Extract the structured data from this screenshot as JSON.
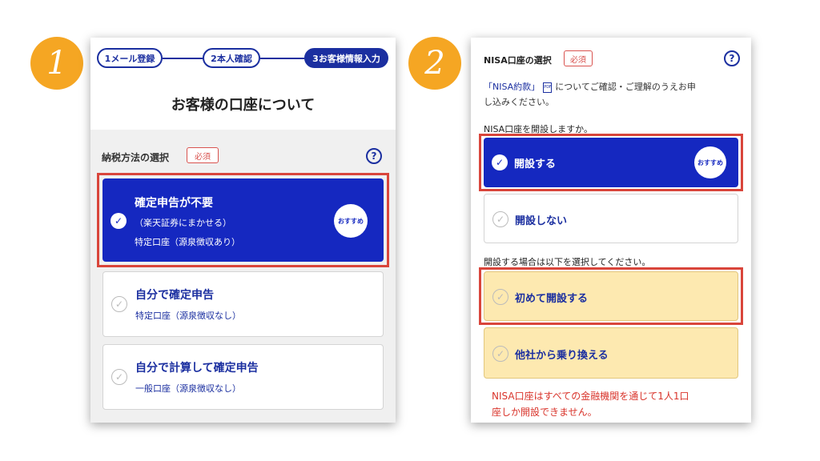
{
  "markers": {
    "first": "1",
    "second": "2"
  },
  "panel1": {
    "steps": [
      "1メール登録",
      "2本人確認",
      "3お客様情報入力"
    ],
    "title": "お客様の口座について",
    "section_label": "納税方法の選択",
    "required_label": "必須",
    "help_label": "?",
    "options": [
      {
        "title": "確定申告が不要",
        "sub1": "（楽天証券にまかせる）",
        "sub2": "特定口座（源泉徴収あり）",
        "badge": "おすすめ",
        "selected": true
      },
      {
        "title": "自分で確定申告",
        "sub1": "特定口座（源泉徴収なし）",
        "selected": false
      },
      {
        "title": "自分で計算して確定申告",
        "sub1": "一般口座（源泉徴収なし）",
        "selected": false
      }
    ]
  },
  "panel2": {
    "section_label": "NISA口座の選択",
    "required_label": "必須",
    "help_label": "?",
    "intro_link": "「NISA約款」",
    "pdf_label": "PDF",
    "intro_text_1": "についてご確認・ご理解のうえお申",
    "intro_text_2": "し込みください。",
    "question": "NISA口座を開設しますか。",
    "open_options": [
      {
        "title": "開設する",
        "badge": "おすすめ",
        "selected": true
      },
      {
        "title": "開設しない",
        "selected": false
      }
    ],
    "sub_question": "開設する場合は以下を選択してください。",
    "type_options": [
      {
        "title": "初めて開設する"
      },
      {
        "title": "他社から乗り換える"
      }
    ],
    "warning_1": "NISA口座はすべての金融機関を通じて1人1口",
    "warning_2": "座しか開設できません。"
  },
  "colors": {
    "primary": "#1528c0",
    "highlight": "#d9453b",
    "marker": "#f5a623",
    "option_yellow": "#fde9b0"
  }
}
